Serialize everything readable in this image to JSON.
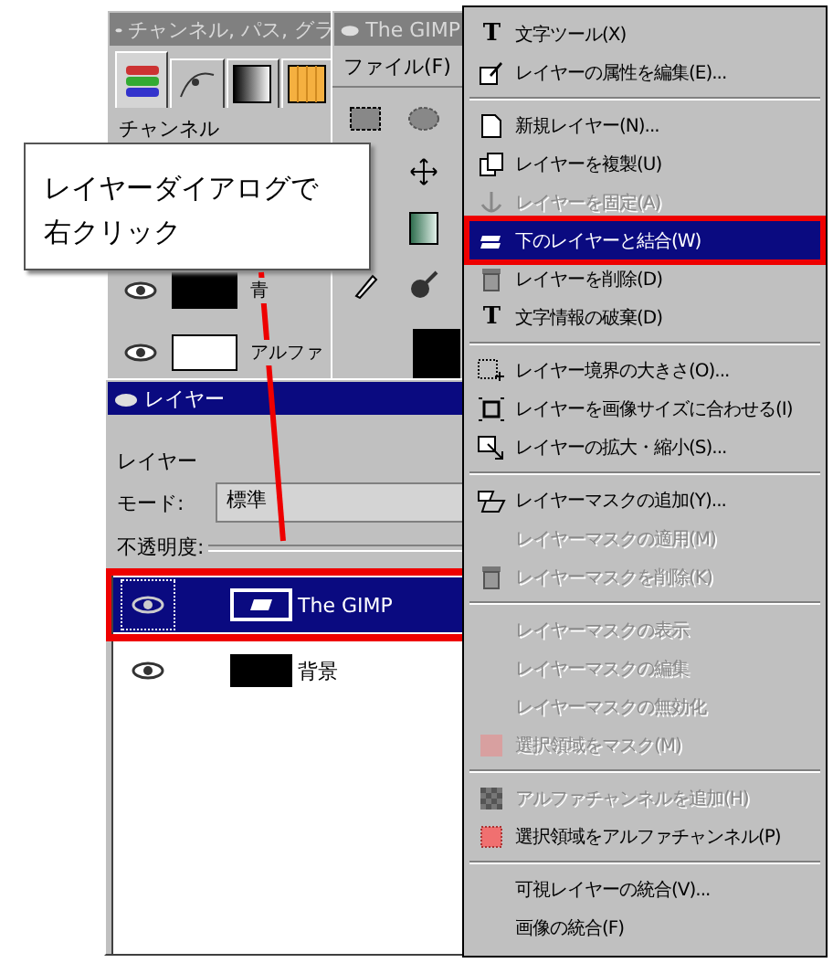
{
  "channels_window": {
    "title": "チャンネル, パス, グラ",
    "tabs": [
      {
        "selected": true
      },
      {
        "selected": false
      },
      {
        "selected": false
      },
      {
        "selected": false
      }
    ],
    "section_label": "チャンネル",
    "channels": [
      {
        "name": "青",
        "visible": true
      },
      {
        "name": "アルファ",
        "visible": true
      }
    ]
  },
  "toolbox": {
    "title": "The GIMP",
    "menu": [
      "ファイル(F)"
    ]
  },
  "layers_window": {
    "title": "レイヤー",
    "label": "レイヤー",
    "mode_label": "モード:",
    "mode": "標準",
    "opacity_label": "不透明度:",
    "layers": [
      {
        "name": "The GIMP",
        "visible": true,
        "selected": true,
        "annotated": true
      },
      {
        "name": "背景",
        "visible": true,
        "selected": false,
        "annotated": false
      }
    ]
  },
  "context_menu": [
    {
      "kind": "item",
      "icon_char": "T",
      "label": "文字ツール(X)",
      "disabled": false,
      "selected": false,
      "annotated": false
    },
    {
      "kind": "item",
      "label": "レイヤーの属性を編集(E)...",
      "disabled": false,
      "selected": false,
      "annotated": false
    },
    {
      "kind": "separator"
    },
    {
      "kind": "item",
      "label": "新規レイヤー(N)...",
      "disabled": false,
      "selected": false,
      "annotated": false
    },
    {
      "kind": "item",
      "label": "レイヤーを複製(U)",
      "disabled": false,
      "selected": false,
      "annotated": false
    },
    {
      "kind": "item",
      "label": "レイヤーを固定(A)",
      "disabled": true,
      "selected": false,
      "annotated": false
    },
    {
      "kind": "item",
      "label": "下のレイヤーと結合(W)",
      "disabled": false,
      "selected": true,
      "annotated": true
    },
    {
      "kind": "item",
      "label": "レイヤーを削除(D)",
      "disabled": false,
      "selected": false,
      "annotated": false
    },
    {
      "kind": "item",
      "icon_char": "T",
      "label": "文字情報の破棄(D)",
      "disabled": false,
      "selected": false,
      "annotated": false
    },
    {
      "kind": "separator"
    },
    {
      "kind": "item",
      "label": "レイヤー境界の大きさ(O)...",
      "disabled": false,
      "selected": false,
      "annotated": false
    },
    {
      "kind": "item",
      "label": "レイヤーを画像サイズに合わせる(I)",
      "disabled": false,
      "selected": false,
      "annotated": false
    },
    {
      "kind": "item",
      "label": "レイヤーの拡大・縮小(S)...",
      "disabled": false,
      "selected": false,
      "annotated": false
    },
    {
      "kind": "separator"
    },
    {
      "kind": "item",
      "label": "レイヤーマスクの追加(Y)...",
      "disabled": false,
      "selected": false,
      "annotated": false
    },
    {
      "kind": "item",
      "label": "レイヤーマスクの適用(M)",
      "disabled": true,
      "selected": false,
      "annotated": false
    },
    {
      "kind": "item",
      "label": "レイヤーマスクを削除(K)",
      "disabled": true,
      "selected": false,
      "annotated": false
    },
    {
      "kind": "separator"
    },
    {
      "kind": "item",
      "label": "レイヤーマスクの表示",
      "disabled": true,
      "selected": false,
      "annotated": false
    },
    {
      "kind": "item",
      "label": "レイヤーマスクの編集",
      "disabled": true,
      "selected": false,
      "annotated": false
    },
    {
      "kind": "item",
      "label": "レイヤーマスクの無効化",
      "disabled": true,
      "selected": false,
      "annotated": false
    },
    {
      "kind": "item",
      "label": "選択領域をマスク(M)",
      "disabled": true,
      "selected": false,
      "annotated": false
    },
    {
      "kind": "separator"
    },
    {
      "kind": "item",
      "label": "アルファチャンネルを追加(H)",
      "disabled": true,
      "selected": false,
      "annotated": false
    },
    {
      "kind": "item",
      "label": "選択領域をアルファチャンネル(P)",
      "disabled": false,
      "selected": false,
      "annotated": false
    },
    {
      "kind": "separator"
    },
    {
      "kind": "item",
      "label": "可視レイヤーの統合(V)...",
      "disabled": false,
      "selected": false,
      "annotated": false
    },
    {
      "kind": "item",
      "label": "画像の統合(F)",
      "disabled": false,
      "selected": false,
      "annotated": false
    }
  ],
  "callout": {
    "text": "レイヤーダイアログで右クリック"
  }
}
